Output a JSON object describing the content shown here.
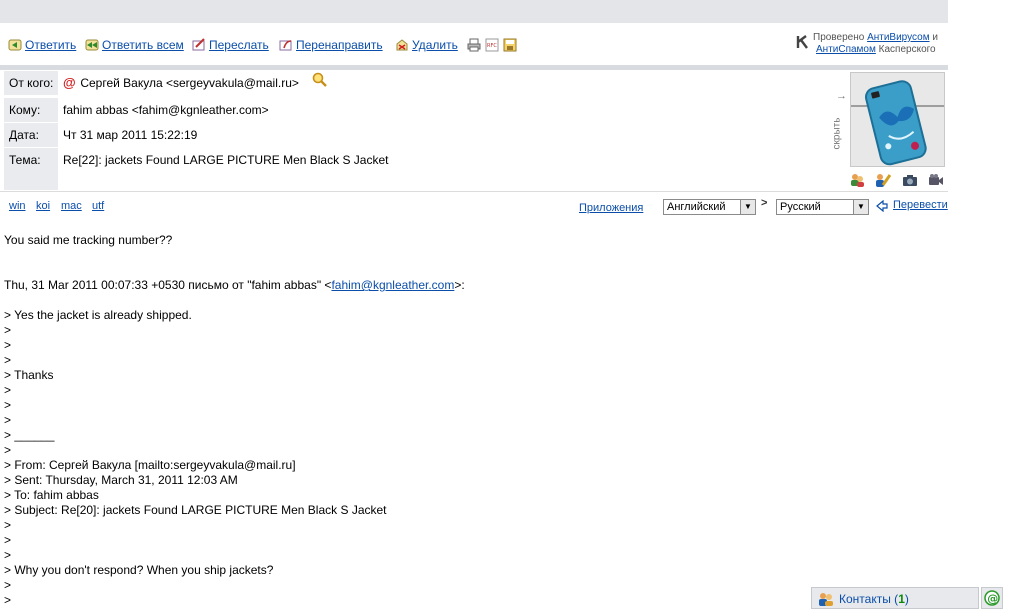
{
  "toolbar": {
    "reply_label": "Ответить",
    "reply_all_label": "Ответить всем",
    "forward_label": "Переслать",
    "redirect_label": "Перенаправить",
    "delete_label": "Удалить",
    "rfc_icon_text": "RFC",
    "kaspersky": {
      "prefix": "Проверено",
      "antivirus": "АнтиВирусом",
      "and": "и",
      "antispam": "АнтиСпамом",
      "suffix": "Касперского"
    }
  },
  "header": {
    "from_label": "От кого:",
    "from_value": "Сергей Вакула <sergeyvakula@mail.ru>",
    "to_label": "Кому:",
    "to_value": "fahim abbas <fahim@kgnleather.com>",
    "date_label": "Дата:",
    "date_value": "Чт 31 мар 2011 15:22:19",
    "subject_label": "Тема:",
    "subject_value": "Re[22]: jackets Found LARGE PICTURE Men Black S Jacket",
    "hide_label": "скрыть",
    "hide_arrow": "→"
  },
  "encodings": [
    "win",
    "koi",
    "mac",
    "utf"
  ],
  "translate": {
    "apps_label": "Приложения",
    "source_lang": "Английский",
    "arrow": ">",
    "target_lang": "Русский",
    "translate_label": "Перевести"
  },
  "body": {
    "line1": "You said me tracking number??",
    "quote_header_prefix": "Thu, 31 Mar 2011 00:07:33 +0530 письмо от \"fahim abbas\" <",
    "quote_header_email": "fahim@kgnleather.com",
    "quote_header_suffix": ">:",
    "quoted_lines": [
      "> Yes the jacket is already shipped.",
      ">",
      ">",
      ">",
      "> Thanks",
      ">",
      ">",
      ">",
      "> ______",
      ">",
      "> From: Сергей Вакула [mailto:sergeyvakula@mail.ru]",
      "> Sent: Thursday, March 31, 2011 12:03 AM",
      "> To: fahim abbas",
      "> Subject: Re[20]: jackets Found LARGE PICTURE Men Black S Jacket",
      ">",
      ">",
      ">",
      "> Why you don't respond? When you ship jackets?",
      ">",
      ">"
    ]
  },
  "contacts": {
    "label": "Контакты",
    "open_paren": " (",
    "count": "1",
    "close_paren": ")"
  },
  "colors": {
    "link": "#0b4eaa",
    "label_bg": "#e9ebef",
    "top_band": "#e3e5e9",
    "count_green": "#0a8a0a"
  }
}
